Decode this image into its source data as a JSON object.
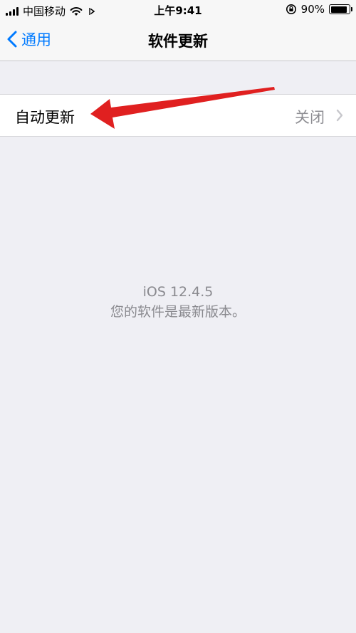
{
  "status_bar": {
    "carrier": "中国移动",
    "time": "上午9:41",
    "battery_percent": "90%",
    "battery_level": 0.9
  },
  "nav": {
    "back_label": "通用",
    "title": "软件更新"
  },
  "settings": {
    "auto_update_label": "自动更新",
    "auto_update_value": "关闭"
  },
  "info": {
    "version": "iOS 12.4.5",
    "status": "您的软件是最新版本。"
  },
  "colors": {
    "accent": "#007aff",
    "annotation_arrow": "#e02020"
  },
  "icons": [
    "signal-icon",
    "wifi-icon",
    "location-icon",
    "rotation-lock-icon",
    "battery-icon",
    "chevron-left-icon",
    "chevron-right-icon",
    "arrow-annotation-icon"
  ]
}
